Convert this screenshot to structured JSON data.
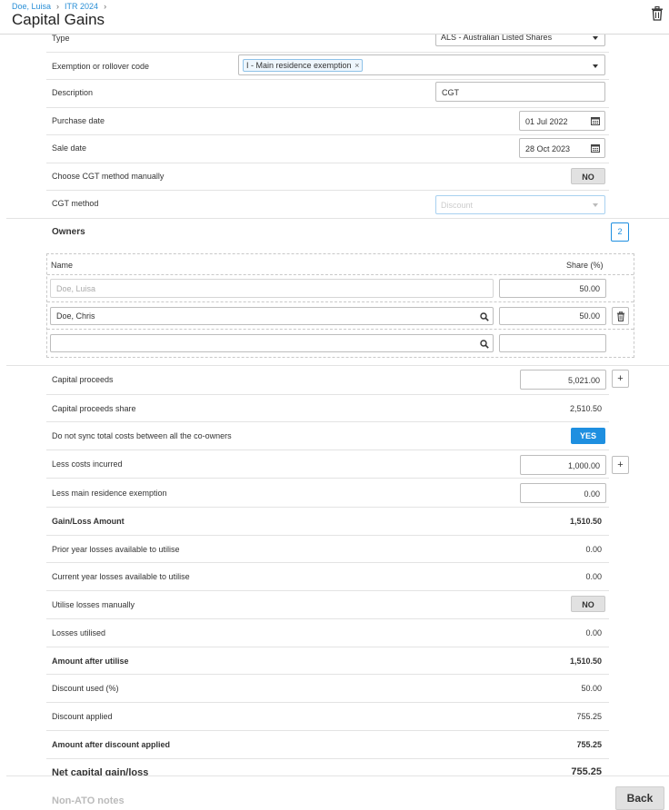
{
  "breadcrumb": [
    "Doe, Luisa",
    "ITR 2024"
  ],
  "page_title": "Capital Gains",
  "fields": {
    "type": {
      "label": "Type",
      "value": "ALS - Australian Listed Shares"
    },
    "exemption": {
      "label": "Exemption or rollover code",
      "chip": "I - Main residence exemption",
      "chip_close": "×"
    },
    "description": {
      "label": "Description",
      "value": "CGT"
    },
    "purchase_date": {
      "label": "Purchase date",
      "value": "01 Jul 2022"
    },
    "sale_date": {
      "label": "Sale date",
      "value": "28 Oct 2023"
    },
    "choose_cgt_manual": {
      "label": "Choose CGT method manually",
      "toggle": "NO"
    },
    "cgt_method": {
      "label": "CGT method",
      "placeholder": "Discount"
    }
  },
  "owners": {
    "title": "Owners",
    "count": "2",
    "header_name": "Name",
    "header_share": "Share (%)",
    "rows": [
      {
        "name": "Doe, Luisa",
        "share": "50.00"
      },
      {
        "name": "Doe, Chris",
        "share": "50.00"
      },
      {
        "name": "",
        "share": ""
      }
    ]
  },
  "calc": {
    "capital_proceeds": {
      "label": "Capital proceeds",
      "value": "5,021.00",
      "plus": "+"
    },
    "capital_proceeds_share": {
      "label": "Capital proceeds share",
      "value": "2,510.50"
    },
    "no_sync": {
      "label": "Do not sync total costs between all the co-owners",
      "toggle": "YES"
    },
    "less_costs": {
      "label": "Less costs incurred",
      "value": "1,000.00",
      "plus": "+"
    },
    "less_main_res": {
      "label": "Less main residence exemption",
      "value": "0.00"
    },
    "gain_loss": {
      "label": "Gain/Loss Amount",
      "value": "1,510.50"
    },
    "prior_year": {
      "label": "Prior year losses available to utilise",
      "value": "0.00"
    },
    "current_year": {
      "label": "Current year losses available to utilise",
      "value": "0.00"
    },
    "utilise_manual": {
      "label": "Utilise losses manually",
      "toggle": "NO"
    },
    "losses_utilised": {
      "label": "Losses utilised",
      "value": "0.00"
    },
    "amount_after_utilise": {
      "label": "Amount after utilise",
      "value": "1,510.50"
    },
    "discount_used": {
      "label": "Discount used (%)",
      "value": "50.00"
    },
    "discount_applied": {
      "label": "Discount applied",
      "value": "755.25"
    },
    "amount_after_discount": {
      "label": "Amount after discount applied",
      "value": "755.25"
    },
    "net_cgt": {
      "label": "Net capital gain/loss",
      "value": "755.25"
    }
  },
  "footer": {
    "notes_label": "Non-ATO notes",
    "back_label": "Back"
  }
}
